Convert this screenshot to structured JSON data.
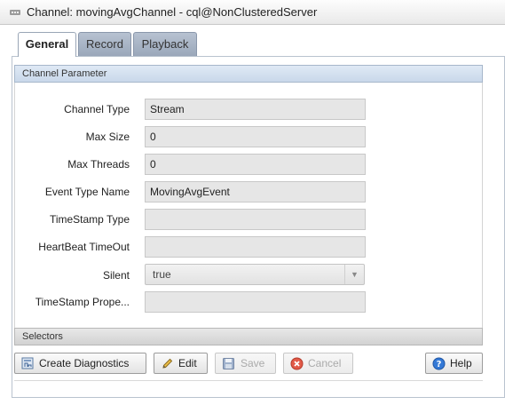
{
  "window": {
    "title": "Channel: movingAvgChannel - cql@NonClusteredServer"
  },
  "tabs": [
    {
      "label": "General",
      "active": true
    },
    {
      "label": "Record",
      "active": false
    },
    {
      "label": "Playback",
      "active": false
    }
  ],
  "sections": {
    "channel_parameter": "Channel Parameter",
    "selectors": "Selectors"
  },
  "fields": {
    "channel_type": {
      "label": "Channel Type",
      "value": "Stream"
    },
    "max_size": {
      "label": "Max Size",
      "value": "0"
    },
    "max_threads": {
      "label": "Max Threads",
      "value": "0"
    },
    "event_type_name": {
      "label": "Event Type Name",
      "value": "MovingAvgEvent"
    },
    "timestamp_type": {
      "label": "TimeStamp Type",
      "value": ""
    },
    "heartbeat_timeout": {
      "label": "HeartBeat TimeOut",
      "value": ""
    },
    "silent": {
      "label": "Silent",
      "value": "true"
    },
    "timestamp_property": {
      "label": "TimeStamp Prope...",
      "value": ""
    }
  },
  "buttons": {
    "create_diagnostics": "Create Diagnostics",
    "edit": "Edit",
    "save": "Save",
    "cancel": "Cancel",
    "help": "Help"
  },
  "icons": {
    "title": "channel-icon",
    "create_diagnostics": "diagnostics-icon",
    "edit": "pencil-icon",
    "save": "floppy-disk-icon",
    "cancel": "cancel-icon",
    "help": "help-icon"
  },
  "colors": {
    "tab_inactive": "#9aa7ba",
    "section_header": "#c9d8ea",
    "field_readonly_bg": "#e6e6e6",
    "help_icon": "#2d6fd1",
    "cancel_icon": "#d23a2a"
  }
}
